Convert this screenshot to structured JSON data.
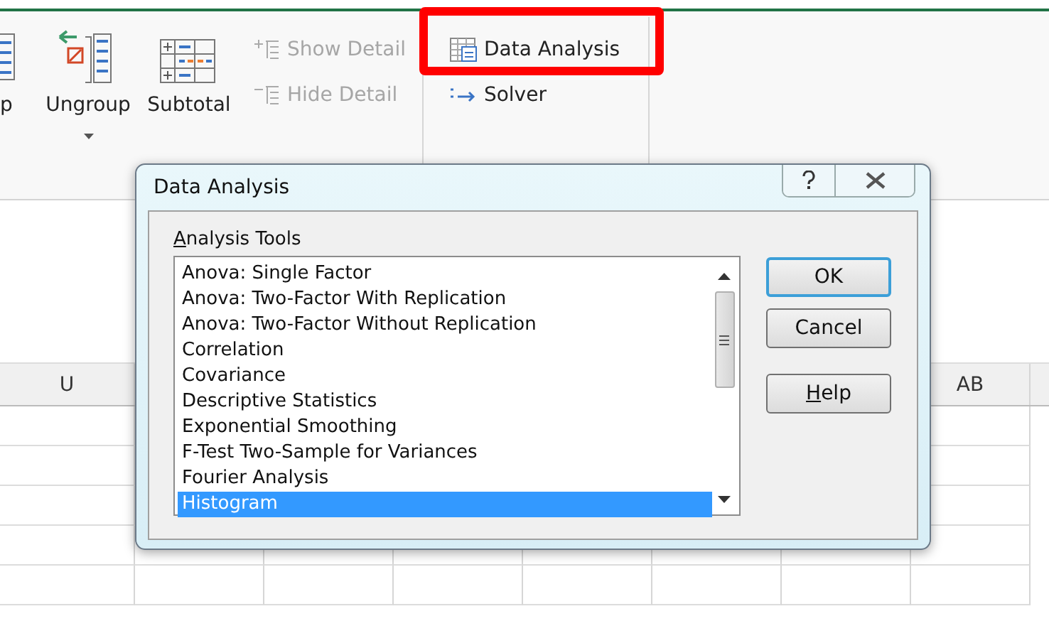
{
  "ribbon": {
    "large_buttons": [
      {
        "label": "p",
        "kind": "cut"
      },
      {
        "label": "Ungroup",
        "kind": "ungroup",
        "dropdown": true
      },
      {
        "label": "Subtotal",
        "kind": "subtotal",
        "dropdown": false
      }
    ],
    "outline_buttons": [
      {
        "label": "Show Detail",
        "kind": "show",
        "disabled": true
      },
      {
        "label": "Hide Detail",
        "kind": "hide",
        "disabled": true
      }
    ],
    "analysis_buttons": [
      {
        "label": "Data Analysis",
        "kind": "analysis",
        "highlighted": true
      },
      {
        "label": "Solver",
        "kind": "solver",
        "highlighted": false
      }
    ]
  },
  "sheet": {
    "column_headers": [
      {
        "label": "U"
      },
      {
        "label": "AB"
      }
    ]
  },
  "dialog": {
    "title": "Data Analysis",
    "list_label": {
      "label": "Analysis Tools",
      "mnemonic": true
    },
    "items": [
      {
        "label": "Anova: Single Factor",
        "selected": false
      },
      {
        "label": "Anova: Two-Factor With Replication",
        "selected": false
      },
      {
        "label": "Anova: Two-Factor Without Replication",
        "selected": false
      },
      {
        "label": "Correlation",
        "selected": false
      },
      {
        "label": "Covariance",
        "selected": false
      },
      {
        "label": "Descriptive Statistics",
        "selected": false
      },
      {
        "label": "Exponential Smoothing",
        "selected": false
      },
      {
        "label": "F-Test Two-Sample for Variances",
        "selected": false
      },
      {
        "label": "Fourier Analysis",
        "selected": false
      },
      {
        "label": "Histogram",
        "selected": true
      }
    ],
    "buttons": [
      {
        "label": "OK",
        "default": true,
        "mnemonic": false
      },
      {
        "label": "Cancel",
        "default": false,
        "mnemonic": false
      },
      {
        "label": "Help",
        "default": false,
        "mnemonic": true
      }
    ]
  }
}
